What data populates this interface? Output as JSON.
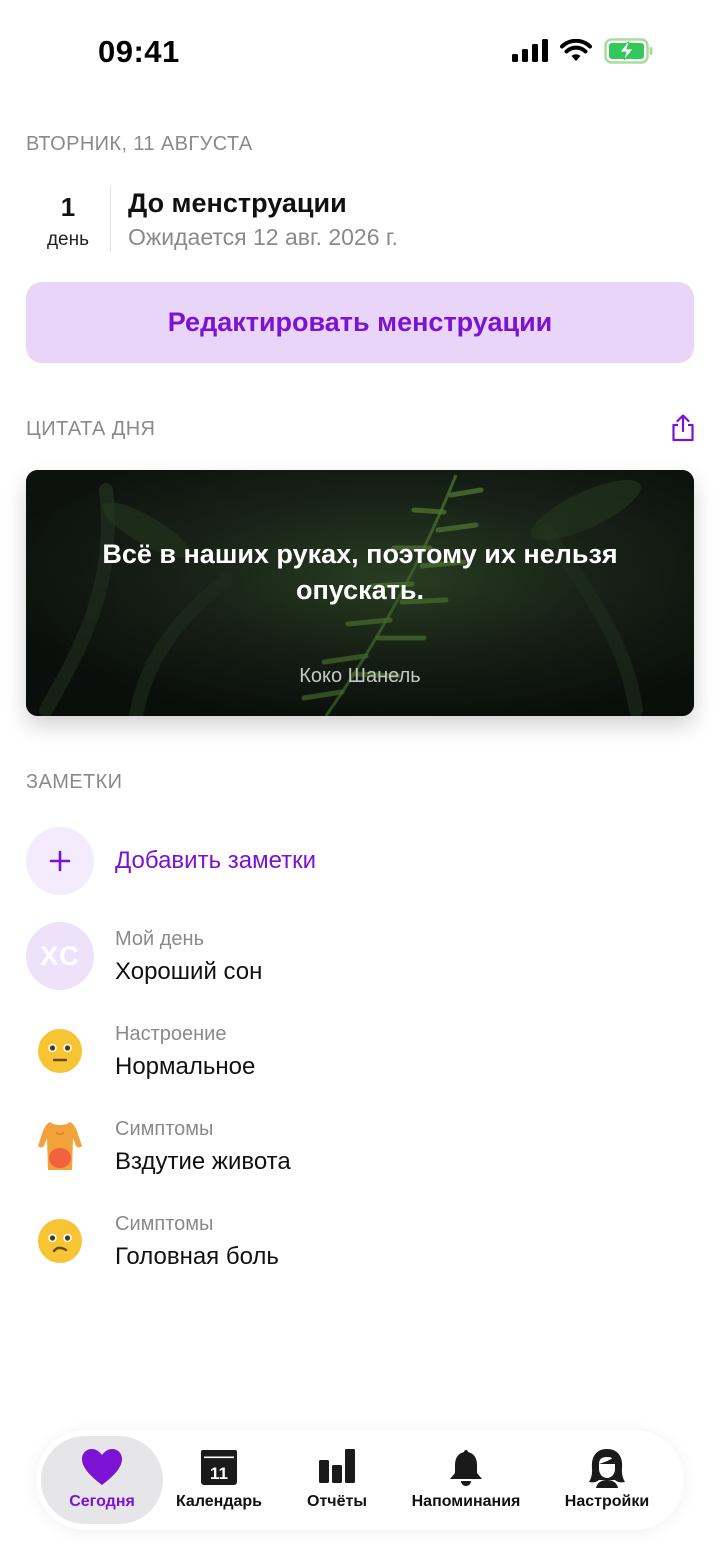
{
  "status_bar": {
    "time": "09:41"
  },
  "today": {
    "date_label": "ВТОРНИК, 11 АВГУСТА",
    "days_count": "1",
    "days_unit": "день",
    "title": "До менструации",
    "subtitle": "Ожидается 12 авг. 2026 г.",
    "edit_button": "Редактировать менструации"
  },
  "quote": {
    "section_label": "ЦИТАТА ДНЯ",
    "text": "Всё в наших руках, поэтому их нельзя опускать.",
    "author": "Коко Шанель"
  },
  "notes": {
    "section_label": "ЗАМЕТКИ",
    "add_label": "Добавить заметки",
    "items": [
      {
        "icon": "initials-avatar",
        "initials": "XC",
        "caption": "Мой день",
        "value": "Хороший сон"
      },
      {
        "icon": "neutral-face-icon",
        "caption": "Настроение",
        "value": "Нормальное"
      },
      {
        "icon": "bloating-body-icon",
        "caption": "Симптомы",
        "value": "Вздутие живота"
      },
      {
        "icon": "headache-face-icon",
        "caption": "Симптомы",
        "value": "Головная боль"
      }
    ]
  },
  "tab_bar": {
    "active": "Сегодня",
    "tabs": [
      {
        "label": "Сегодня",
        "icon": "heart-icon"
      },
      {
        "label": "Календарь",
        "icon": "calendar-icon",
        "badge": "11"
      },
      {
        "label": "Отчёты",
        "icon": "bar-chart-icon"
      },
      {
        "label": "Напоминания",
        "icon": "bell-icon"
      },
      {
        "label": "Настройки",
        "icon": "profile-icon"
      }
    ]
  },
  "colors": {
    "accent": "#7b12d4",
    "accent_light": "#e8d5f8",
    "muted_text": "#8a8a8e"
  }
}
